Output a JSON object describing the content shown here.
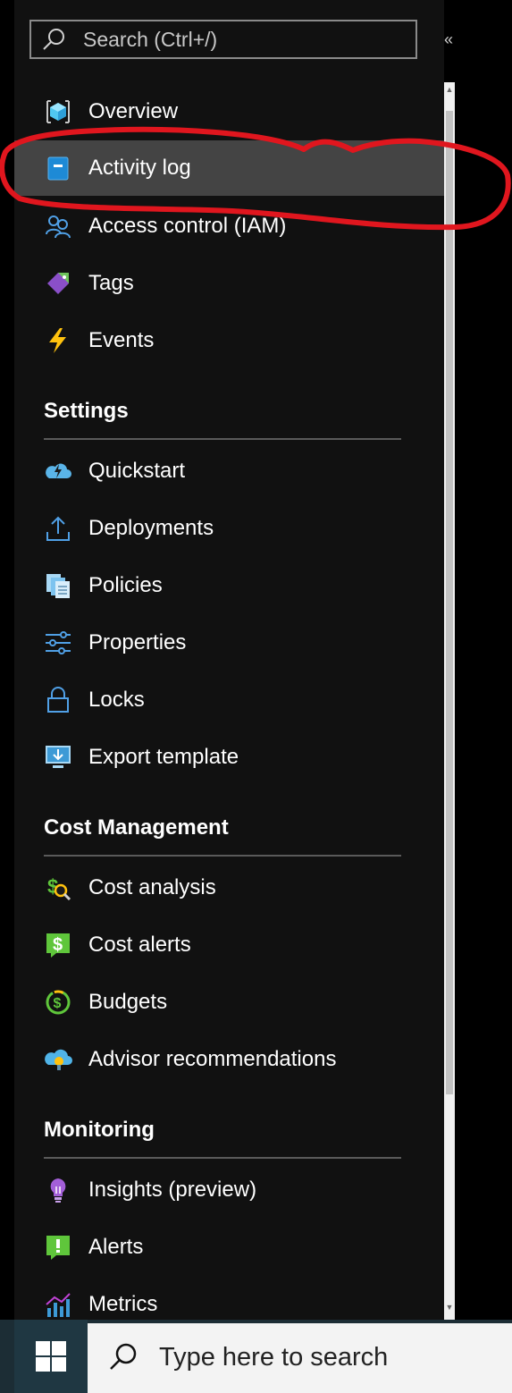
{
  "search": {
    "placeholder": "Search (Ctrl+/)"
  },
  "collapse_glyph": "«",
  "nav_top": [
    {
      "label": "Overview",
      "icon": "cube-icon"
    },
    {
      "label": "Activity log",
      "icon": "activity-log-icon",
      "selected": true
    },
    {
      "label": "Access control (IAM)",
      "icon": "people-icon"
    },
    {
      "label": "Tags",
      "icon": "tag-icon"
    },
    {
      "label": "Events",
      "icon": "lightning-icon"
    }
  ],
  "sections": [
    {
      "title": "Settings",
      "items": [
        {
          "label": "Quickstart",
          "icon": "cloud-lightning-icon"
        },
        {
          "label": "Deployments",
          "icon": "upload-icon"
        },
        {
          "label": "Policies",
          "icon": "documents-icon"
        },
        {
          "label": "Properties",
          "icon": "sliders-icon"
        },
        {
          "label": "Locks",
          "icon": "lock-icon"
        },
        {
          "label": "Export template",
          "icon": "export-monitor-icon"
        }
      ]
    },
    {
      "title": "Cost Management",
      "items": [
        {
          "label": "Cost analysis",
          "icon": "cost-analysis-icon"
        },
        {
          "label": "Cost alerts",
          "icon": "cost-alert-icon"
        },
        {
          "label": "Budgets",
          "icon": "budget-icon"
        },
        {
          "label": "Advisor recommendations",
          "icon": "advisor-cloud-icon"
        }
      ]
    },
    {
      "title": "Monitoring",
      "items": [
        {
          "label": "Insights (preview)",
          "icon": "lightbulb-icon"
        },
        {
          "label": "Alerts",
          "icon": "alert-icon"
        },
        {
          "label": "Metrics",
          "icon": "metrics-chart-icon"
        }
      ]
    }
  ],
  "taskbar": {
    "search_text": "Type here to search"
  },
  "colors": {
    "panel_bg": "#111111",
    "selected_bg": "#444444",
    "annotation": "#e0161e",
    "taskbar_bg": "#1c2d35"
  }
}
